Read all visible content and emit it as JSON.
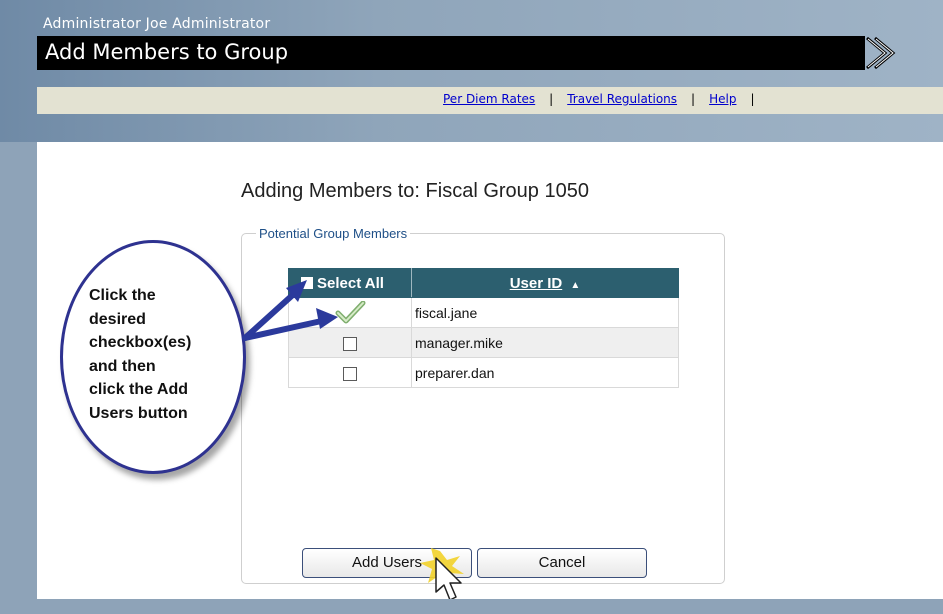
{
  "header": {
    "user_line": "Administrator Joe Administrator",
    "title": "Add Members to Group"
  },
  "nav": {
    "links": [
      "Per Diem Rates",
      "Travel Regulations",
      "Help"
    ],
    "separator": "|"
  },
  "main": {
    "heading": "Adding Members to: Fiscal Group 1050",
    "fieldset_legend": "Potential Group Members",
    "table": {
      "select_all_label": "Select All",
      "user_id_header": "User ID",
      "sort_icon": "sort-ascending-icon",
      "rows": [
        {
          "user_id": "fiscal.jane",
          "checked": true
        },
        {
          "user_id": "manager.mike",
          "checked": false
        },
        {
          "user_id": "preparer.dan",
          "checked": false
        }
      ]
    },
    "buttons": {
      "add_users": "Add Users",
      "cancel": "Cancel"
    }
  },
  "callout": {
    "lines": [
      "Click the",
      "desired",
      "checkbox(es)",
      "and then",
      "click the Add",
      "Users button"
    ]
  },
  "colors": {
    "header_black": "#000000",
    "nav_bar": "#e3e2d2",
    "table_header": "#2c5f6f",
    "link": "#0000cc",
    "callout_border": "#2e3290",
    "arrow": "#2b3a9c"
  }
}
